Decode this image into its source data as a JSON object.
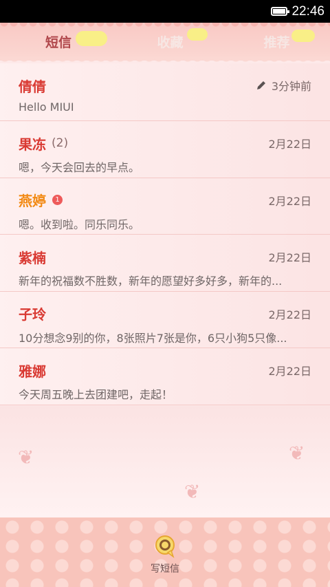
{
  "status_bar": {
    "time": "22:46",
    "battery_icon": "battery-icon"
  },
  "tabs": [
    {
      "label": "短信",
      "active": true
    },
    {
      "label": "收藏",
      "active": false
    },
    {
      "label": "推荐",
      "active": false
    }
  ],
  "conversations": [
    {
      "name": "倩倩",
      "count": "",
      "badge": "",
      "time": "3分钟前",
      "preview": "Hello MIUI",
      "draft_icon": "pencil-icon"
    },
    {
      "name": "果冻",
      "count": "(2)",
      "badge": "",
      "time": "2月22日",
      "preview": "嗯，今天会回去的早点。"
    },
    {
      "name": "燕婷",
      "count": "",
      "badge": "1",
      "time": "2月22日",
      "preview": "嗯。收到啦。同乐同乐。"
    },
    {
      "name": "紫楠",
      "count": "",
      "badge": "",
      "time": "2月22日",
      "preview": "新年的祝福数不胜数，新年的愿望好多好多，新年的..."
    },
    {
      "name": "子玲",
      "count": "",
      "badge": "",
      "time": "2月22日",
      "preview": "10分想念9别的你，8张照片7张是你，6只小狗5只像..."
    },
    {
      "name": "雅娜",
      "count": "",
      "badge": "",
      "time": "2月22日",
      "preview": "今天周五晚上去团建吧，走起！"
    }
  ],
  "bottom_bar": {
    "compose_label": "写短信",
    "compose_icon": "compose-message-icon"
  },
  "colors": {
    "name_red": "#d93a33",
    "name_unread": "#f28a14",
    "tab_active": "#b0474b"
  }
}
